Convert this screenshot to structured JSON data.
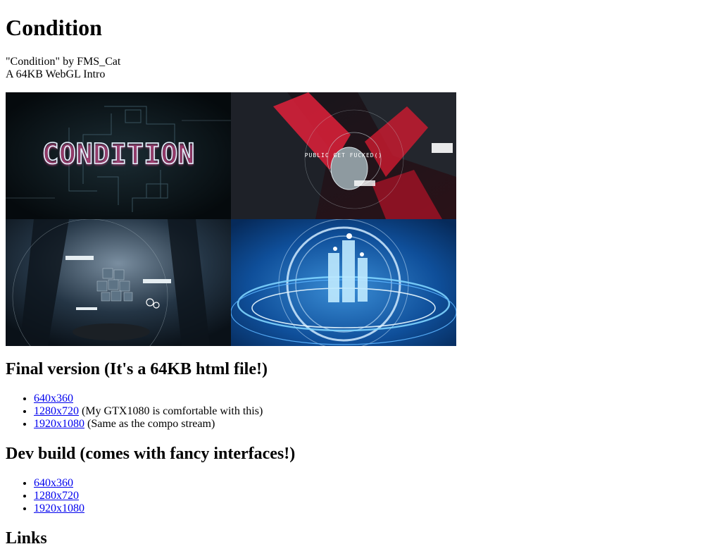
{
  "page": {
    "title": "Condition",
    "byline": "\"Condition\" by FMS_Cat",
    "subtitle": "A 64KB WebGL Intro"
  },
  "screenshots": {
    "title_card_text": "CONDITION",
    "hud_text": "PUBLIC GET FUCKED()"
  },
  "final_version": {
    "heading": "Final version (It's a 64KB html file!)",
    "items": [
      {
        "link": "640x360",
        "note": ""
      },
      {
        "link": "1280x720",
        "note": " (My GTX1080 is comfortable with this)"
      },
      {
        "link": "1920x1080",
        "note": " (Same as the compo stream)"
      }
    ]
  },
  "dev_build": {
    "heading": "Dev build (comes with fancy interfaces!)",
    "items": [
      {
        "link": "640x360"
      },
      {
        "link": "1280x720"
      },
      {
        "link": "1920x1080"
      }
    ]
  },
  "links": {
    "heading": "Links"
  }
}
